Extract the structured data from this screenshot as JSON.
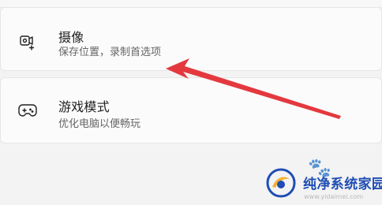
{
  "settings": {
    "items": [
      {
        "title": "摄像",
        "subtitle": "保存位置，录制首选项",
        "icon": "camera-record-icon"
      },
      {
        "title": "游戏模式",
        "subtitle": "优化电脑以便畅玩",
        "icon": "game-controller-icon"
      }
    ]
  },
  "watermark": {
    "brand": "纯净系统家园",
    "url": "www.yidaimei.com"
  },
  "colors": {
    "background": "#f3f3f3",
    "card": "#fbfbfb",
    "arrow": "#e4383f",
    "watermark_blue": "#1f4db4"
  }
}
